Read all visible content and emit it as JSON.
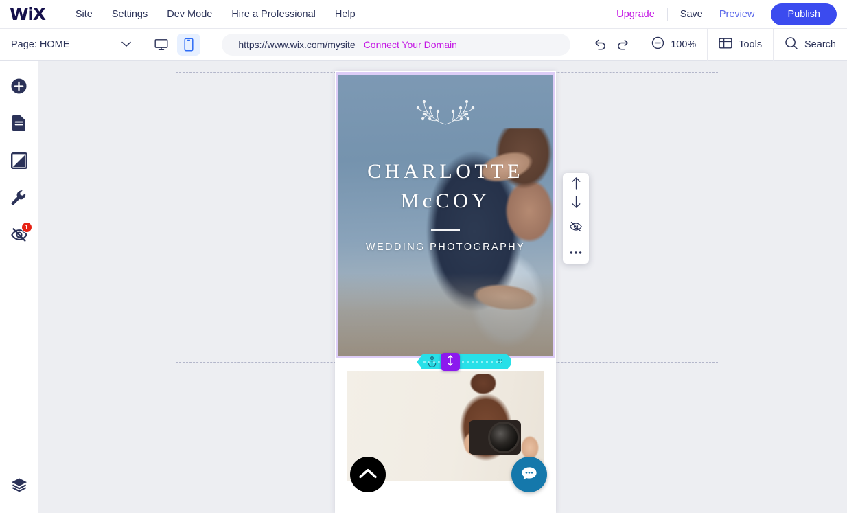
{
  "topbar": {
    "logo": "WiX",
    "menu": [
      {
        "label": "Site",
        "name": "menu-site"
      },
      {
        "label": "Settings",
        "name": "menu-settings"
      },
      {
        "label": "Dev Mode",
        "name": "menu-dev-mode"
      },
      {
        "label": "Hire a Professional",
        "name": "menu-hire-a-professional"
      },
      {
        "label": "Help",
        "name": "menu-help"
      }
    ],
    "upgrade": "Upgrade",
    "save": "Save",
    "preview": "Preview",
    "publish": "Publish",
    "colors": {
      "upgrade": "#c418e4",
      "preview": "#5a67ea",
      "publish_bg": "#3b4bef",
      "text": "#2b3258"
    }
  },
  "toolbar": {
    "page_label": "Page: HOME",
    "chevron_icon": "chevron-down-icon",
    "devices": [
      {
        "icon": "desktop-icon",
        "name": "desktop-view-button",
        "active": false
      },
      {
        "icon": "mobile-icon",
        "name": "mobile-view-button",
        "active": true
      }
    ],
    "url": "https://www.wix.com/mysite",
    "connect_domain": "Connect Your Domain",
    "undo_icon": "undo-icon",
    "redo_icon": "redo-icon",
    "zoom_icon": "zoom-out-icon",
    "zoom_level": "100%",
    "tools_icon": "panels-icon",
    "tools_label": "Tools",
    "search_icon": "search-icon",
    "search_label": "Search"
  },
  "sidebar": {
    "items": [
      {
        "name": "sidebar-add-button",
        "icon": "plus-circle-icon",
        "badge": null
      },
      {
        "name": "sidebar-pages-button",
        "icon": "page-icon",
        "badge": null
      },
      {
        "name": "sidebar-design-button",
        "icon": "theme-icon",
        "badge": null
      },
      {
        "name": "sidebar-apps-button",
        "icon": "wrench-icon",
        "badge": null
      },
      {
        "name": "sidebar-hidden-elements-button",
        "icon": "eye-hidden-icon",
        "badge": "1"
      }
    ],
    "bottom": {
      "name": "sidebar-layers-button",
      "icon": "layers-icon"
    },
    "badge_color": "#e62214"
  },
  "canvas": {
    "site": {
      "hero": {
        "ornament_icon": "floral-ornament-icon",
        "title_line1": "CHARLOTTE",
        "title_line2": "McCOY",
        "subtitle": "WEDDING PHOTOGRAPHY",
        "selected": true,
        "selection_color": "#ddcdf7"
      },
      "section2": {
        "image_alt": "photographer-holding-camera",
        "back_to_top_icon": "chevron-up-icon",
        "chat_icon": "chat-bubble-icon",
        "chat_color": "#1578ab"
      }
    },
    "float_toolbar": {
      "buttons": [
        {
          "name": "move-up-button",
          "icon": "arrow-up-icon"
        },
        {
          "name": "move-down-button",
          "icon": "arrow-down-icon"
        },
        {
          "name": "hide-element-button",
          "icon": "eye-hidden-icon"
        },
        {
          "name": "more-options-button",
          "icon": "ellipsis-icon"
        }
      ]
    },
    "drag_handle": {
      "anchor_icon": "anchor-icon",
      "resize_icon": "resize-vertical-icon",
      "grip_icon": "grip-dots-icon",
      "bar_color": "#28e0e8",
      "center_color": "#8c19ee"
    }
  }
}
